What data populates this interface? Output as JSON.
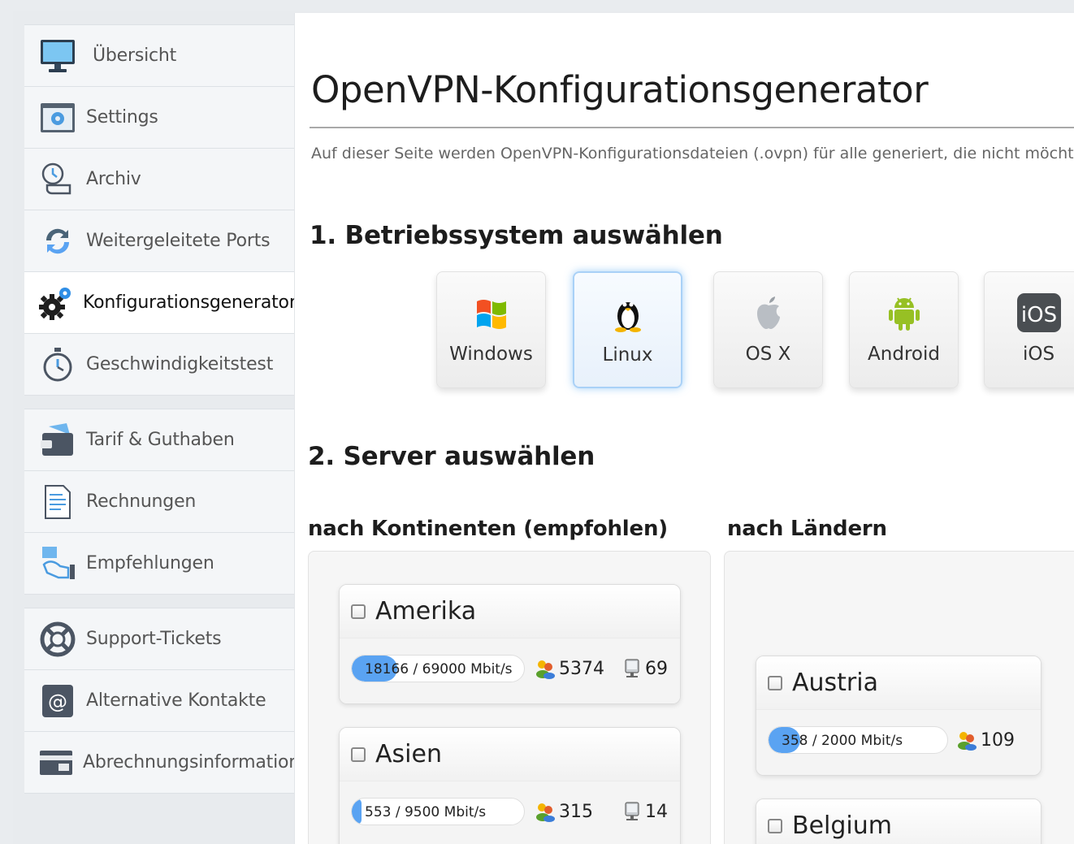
{
  "sidebar": {
    "groups": [
      [
        {
          "label": "Übersicht",
          "icon": "monitor-icon",
          "active": false
        },
        {
          "label": "Settings",
          "icon": "settings-window-icon",
          "active": false
        },
        {
          "label": "Archiv",
          "icon": "archive-clock-icon",
          "active": false
        },
        {
          "label": "Weitergeleitete Ports",
          "icon": "refresh-arrows-icon",
          "active": false
        },
        {
          "label": "Konfigurationsgenerator",
          "icon": "gears-icon",
          "active": true
        },
        {
          "label": "Geschwindigkeitstest",
          "icon": "stopwatch-icon",
          "active": false
        }
      ],
      [
        {
          "label": "Tarif & Guthaben",
          "icon": "wallet-icon",
          "active": false
        },
        {
          "label": "Rechnungen",
          "icon": "invoice-document-icon",
          "active": false
        },
        {
          "label": "Empfehlungen",
          "icon": "referral-hand-icon",
          "active": false
        }
      ],
      [
        {
          "label": "Support-Tickets",
          "icon": "lifebuoy-icon",
          "active": false
        },
        {
          "label": "Alternative Kontakte",
          "icon": "at-sign-icon",
          "active": false
        },
        {
          "label": "Abrechnungsinformationen",
          "icon": "billing-card-icon",
          "active": false
        }
      ]
    ]
  },
  "main": {
    "title": "OpenVPN-Konfigurationsgenerator",
    "intro": "Auf dieser Seite werden OpenVPN-Konfigurationsdateien (.ovpn) für alle generiert, die nicht möchten ...",
    "step1_title": "1. Betriebssystem auswählen",
    "os_options": [
      {
        "label": "Windows",
        "icon": "windows-logo-icon",
        "selected": false
      },
      {
        "label": "Linux",
        "icon": "linux-penguin-icon",
        "selected": true
      },
      {
        "label": "OS X",
        "icon": "apple-logo-icon",
        "selected": false
      },
      {
        "label": "Android",
        "icon": "android-robot-icon",
        "selected": false
      },
      {
        "label": "iOS",
        "icon": "ios-logo-icon",
        "selected": false
      }
    ],
    "step2_title": "2. Server auswählen",
    "continents_heading": "nach Kontinenten (empfohlen)",
    "countries_heading": "nach Ländern",
    "continents": [
      {
        "name": "Amerika",
        "bw_used": "18166",
        "bw_rest": " / 69000 Mbit/s",
        "bw_fraction": 0.263,
        "users": "5374",
        "servers": "69"
      },
      {
        "name": "Asien",
        "bw_used": "553",
        "bw_rest": " / 9500 Mbit/s",
        "bw_fraction": 0.058,
        "users": "315",
        "servers": "14"
      }
    ],
    "countries": [
      {
        "name": "Austria",
        "bw_used": "358",
        "bw_rest": " / 2000 Mbit/s",
        "bw_fraction": 0.179,
        "users": "109"
      },
      {
        "name": "Belgium"
      }
    ]
  }
}
